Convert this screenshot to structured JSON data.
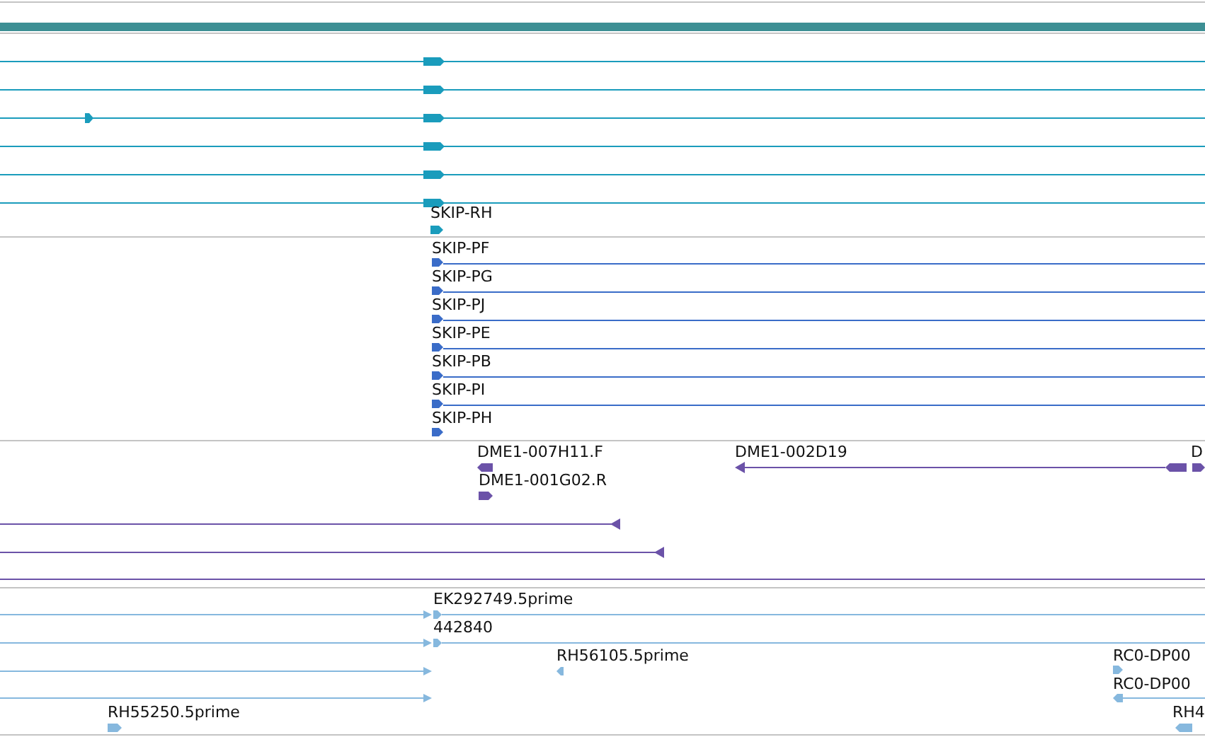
{
  "tracks": [
    {
      "color": "#1a9cbc",
      "features": [
        {
          "label": "SKIP-RH",
          "reverse": false
        }
      ]
    },
    {
      "color": "#3a6cc8",
      "features": [
        {
          "label": "SKIP-PF",
          "reverse": false
        },
        {
          "label": "SKIP-PG",
          "reverse": false
        },
        {
          "label": "SKIP-PJ",
          "reverse": false
        },
        {
          "label": "SKIP-PE",
          "reverse": false
        },
        {
          "label": "SKIP-PB",
          "reverse": false
        },
        {
          "label": "SKIP-PI",
          "reverse": false
        },
        {
          "label": "SKIP-PH",
          "reverse": false
        }
      ]
    },
    {
      "color": "#6b52a8",
      "features": [
        {
          "label": "DME1-007H11.F",
          "reverse": true
        },
        {
          "label": "DME1-002D19",
          "reverse": true
        },
        {
          "label": "D",
          "reverse": false
        },
        {
          "label": "DME1-001G02.R",
          "reverse": false
        }
      ]
    },
    {
      "color": "#86b8de",
      "features": [
        {
          "label": "EK292749.5prime",
          "reverse": false
        },
        {
          "label": "442840",
          "reverse": false
        },
        {
          "label": "RH56105.5prime",
          "reverse": true
        },
        {
          "label": "RC0-DP00",
          "reverse": false
        },
        {
          "label": "RC0-DP00",
          "reverse": true
        },
        {
          "label": "RH55250.5prime",
          "reverse": false
        },
        {
          "label": "RH4",
          "reverse": true
        }
      ]
    }
  ]
}
